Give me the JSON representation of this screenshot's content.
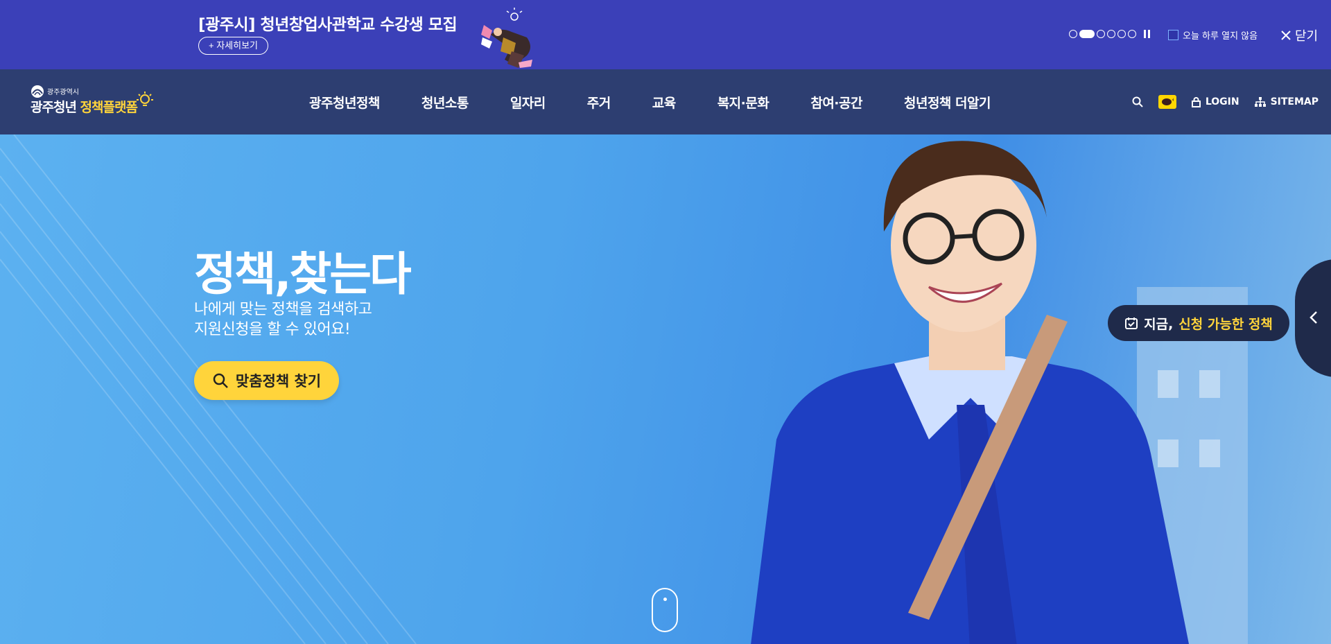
{
  "promo": {
    "title": "[광주시] 청년창업사관학교 수강생 모집",
    "more_label": "+ 자세히보기",
    "slides": [
      false,
      true,
      false,
      false,
      false,
      false
    ],
    "no_show_today_label": "오늘 하루 열지 않음",
    "close_label": "닫기"
  },
  "header": {
    "logo_small": "광주광역시",
    "logo_main": "광주청년",
    "logo_accent": "정책플랫폼",
    "nav": [
      "광주청년정책",
      "청년소통",
      "일자리",
      "주거",
      "교육",
      "복지·문화",
      "참여·공간",
      "청년정책 더알기"
    ],
    "login_label": "LOGIN",
    "sitemap_label": "SITEMAP"
  },
  "hero": {
    "title": "정책,찾는다",
    "desc_line1": "나에게 맞는 정책을 검색하고",
    "desc_line2": "지원신청을 할 수 있어요!",
    "button_label": "맞춤정책 찾기",
    "chip_prefix": "지금,",
    "chip_highlight": "신청 가능한 정책"
  },
  "colors": {
    "promo_bg": "#3b40b8",
    "header_bg": "#2c3a6c",
    "accent_yellow": "#ffd43b",
    "chip_bg": "#1f2a4a"
  }
}
